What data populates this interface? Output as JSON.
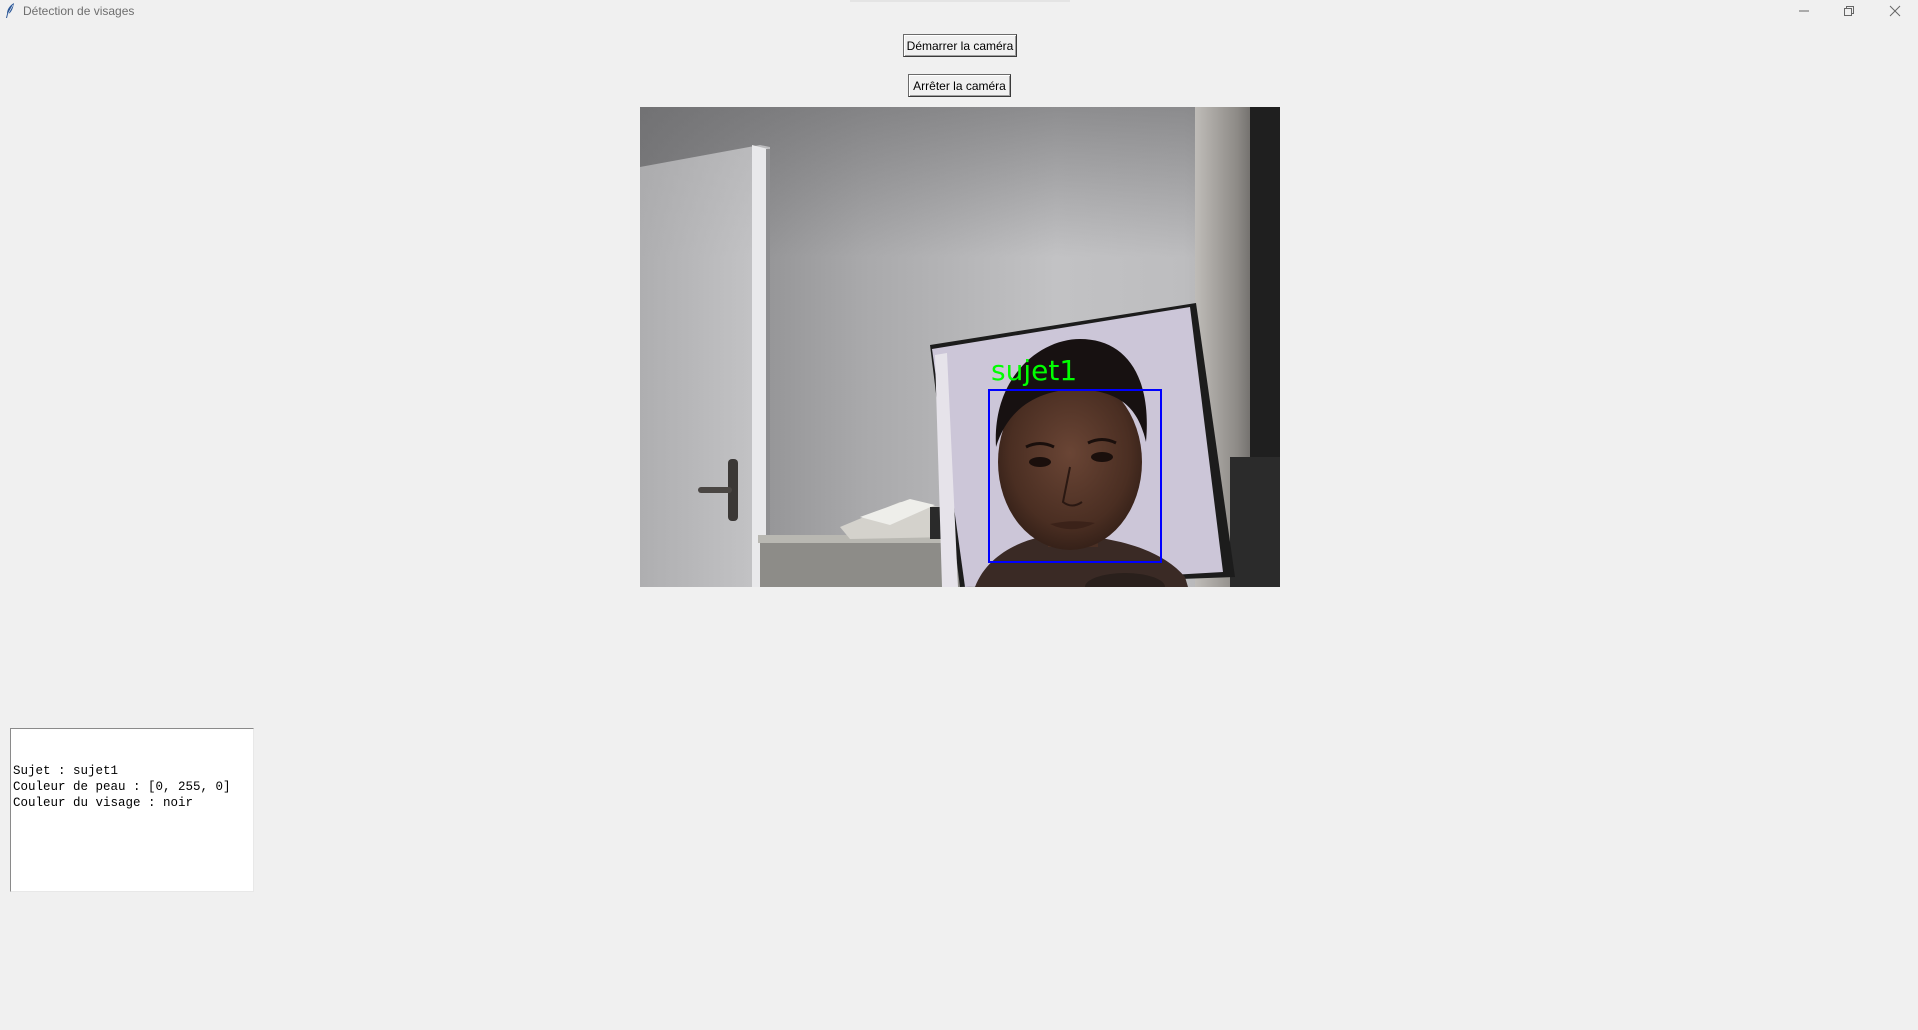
{
  "window": {
    "title": "Détection de visages",
    "icons": {
      "app": "feather-icon",
      "minimize": "minimize-icon",
      "maximize": "restore-icon",
      "close": "close-icon"
    }
  },
  "controls": {
    "start_label": "Démarrer la caméra",
    "stop_label": "Arrêter la caméra"
  },
  "camera": {
    "detection_label": "sujet1",
    "label_color": "#00ff00",
    "box_color": "#0000ff"
  },
  "info": {
    "lines": [
      "Sujet : sujet1",
      "Couleur de peau : [0, 255, 0]",
      "Couleur du visage : noir"
    ]
  }
}
